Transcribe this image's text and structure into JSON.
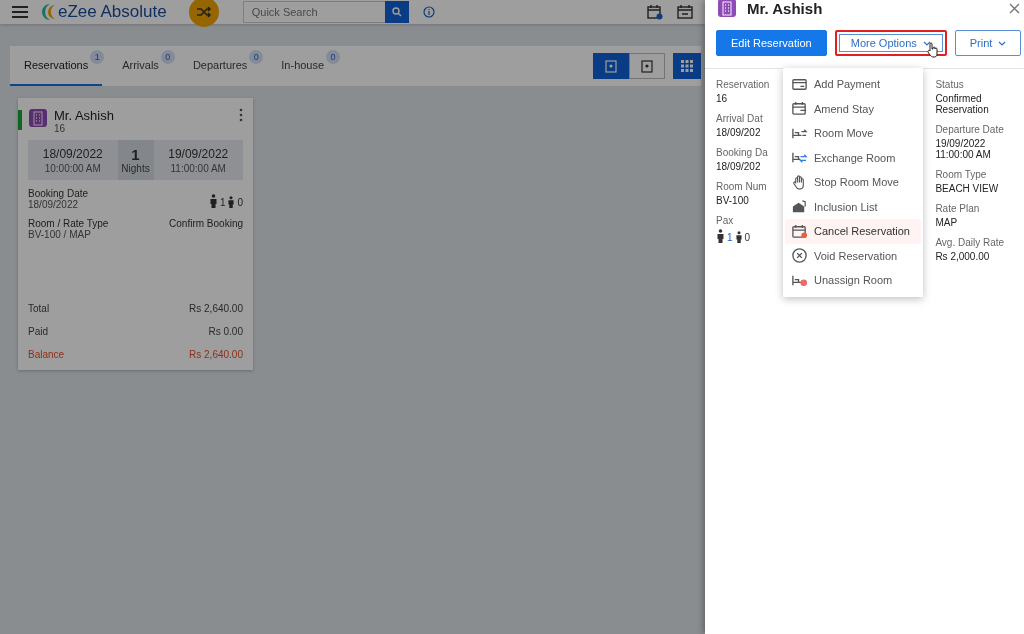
{
  "header": {
    "app_name": "eZee Absolute",
    "search": {
      "placeholder": "Quick Search"
    }
  },
  "tabs": [
    {
      "label": "Reservations",
      "count": "1",
      "selected": true
    },
    {
      "label": "Arrivals",
      "count": "0",
      "selected": false
    },
    {
      "label": "Departures",
      "count": "0",
      "selected": false
    },
    {
      "label": "In-house",
      "count": "0",
      "selected": false
    }
  ],
  "card": {
    "guest": "Mr. Ashish",
    "number": "16",
    "arrival": {
      "date": "18/09/2022",
      "time": "10:00:00 AM"
    },
    "nights": {
      "count": "1",
      "label": "Nights"
    },
    "departure": {
      "date": "19/09/2022",
      "time": "11:00:00 AM"
    },
    "booking_label": "Booking Date",
    "booking_date": "18/09/2022",
    "adults": "1",
    "children": "0",
    "room_label": "Room / Rate Type",
    "room": "BV-100 / MAP",
    "status": "Confirm Booking",
    "totals": [
      {
        "label": "Total",
        "value": "Rs 2,640.00",
        "kind": "normal"
      },
      {
        "label": "Paid",
        "value": "Rs 0.00",
        "kind": "normal"
      },
      {
        "label": "Balance",
        "value": "Rs 2,640.00",
        "kind": "due"
      }
    ]
  },
  "panel": {
    "title": "Mr. Ashish",
    "buttons": [
      {
        "label": "Edit Reservation",
        "kind": "primary",
        "highlighted": false
      },
      {
        "label": "More Options",
        "kind": "dropdown",
        "highlighted": true
      },
      {
        "label": "Print",
        "kind": "dropdown",
        "highlighted": false
      }
    ],
    "fields_left": [
      {
        "label": "Reservation",
        "value": "16"
      },
      {
        "label": "Arrival Dat",
        "value": "18/09/202"
      },
      {
        "label": "Booking Da",
        "value": "18/09/202"
      },
      {
        "label": "Room Num",
        "value": "BV-100"
      }
    ],
    "pax": {
      "label": "Pax",
      "adults": "1",
      "children": "0"
    },
    "fields_right": [
      {
        "label": "Status",
        "value": "Confirmed Reservation"
      },
      {
        "label": "Departure Date",
        "value": "19/09/2022 11:00:00 AM"
      },
      {
        "label": "Room Type",
        "value": "BEACH VIEW"
      },
      {
        "label": "Rate Plan",
        "value": "MAP"
      },
      {
        "label": "Avg. Daily Rate",
        "value": "Rs 2,000.00"
      }
    ]
  },
  "menu": [
    {
      "label": "Add Payment",
      "highlighted": false
    },
    {
      "label": "Amend Stay",
      "highlighted": false
    },
    {
      "label": "Room Move",
      "highlighted": false
    },
    {
      "label": "Exchange Room",
      "highlighted": false
    },
    {
      "label": "Stop Room Move",
      "highlighted": false
    },
    {
      "label": "Inclusion List",
      "highlighted": false
    },
    {
      "label": "Cancel Reservation",
      "highlighted": true
    },
    {
      "label": "Void Reservation",
      "highlighted": false
    },
    {
      "label": "Unassign Room",
      "highlighted": false
    }
  ]
}
